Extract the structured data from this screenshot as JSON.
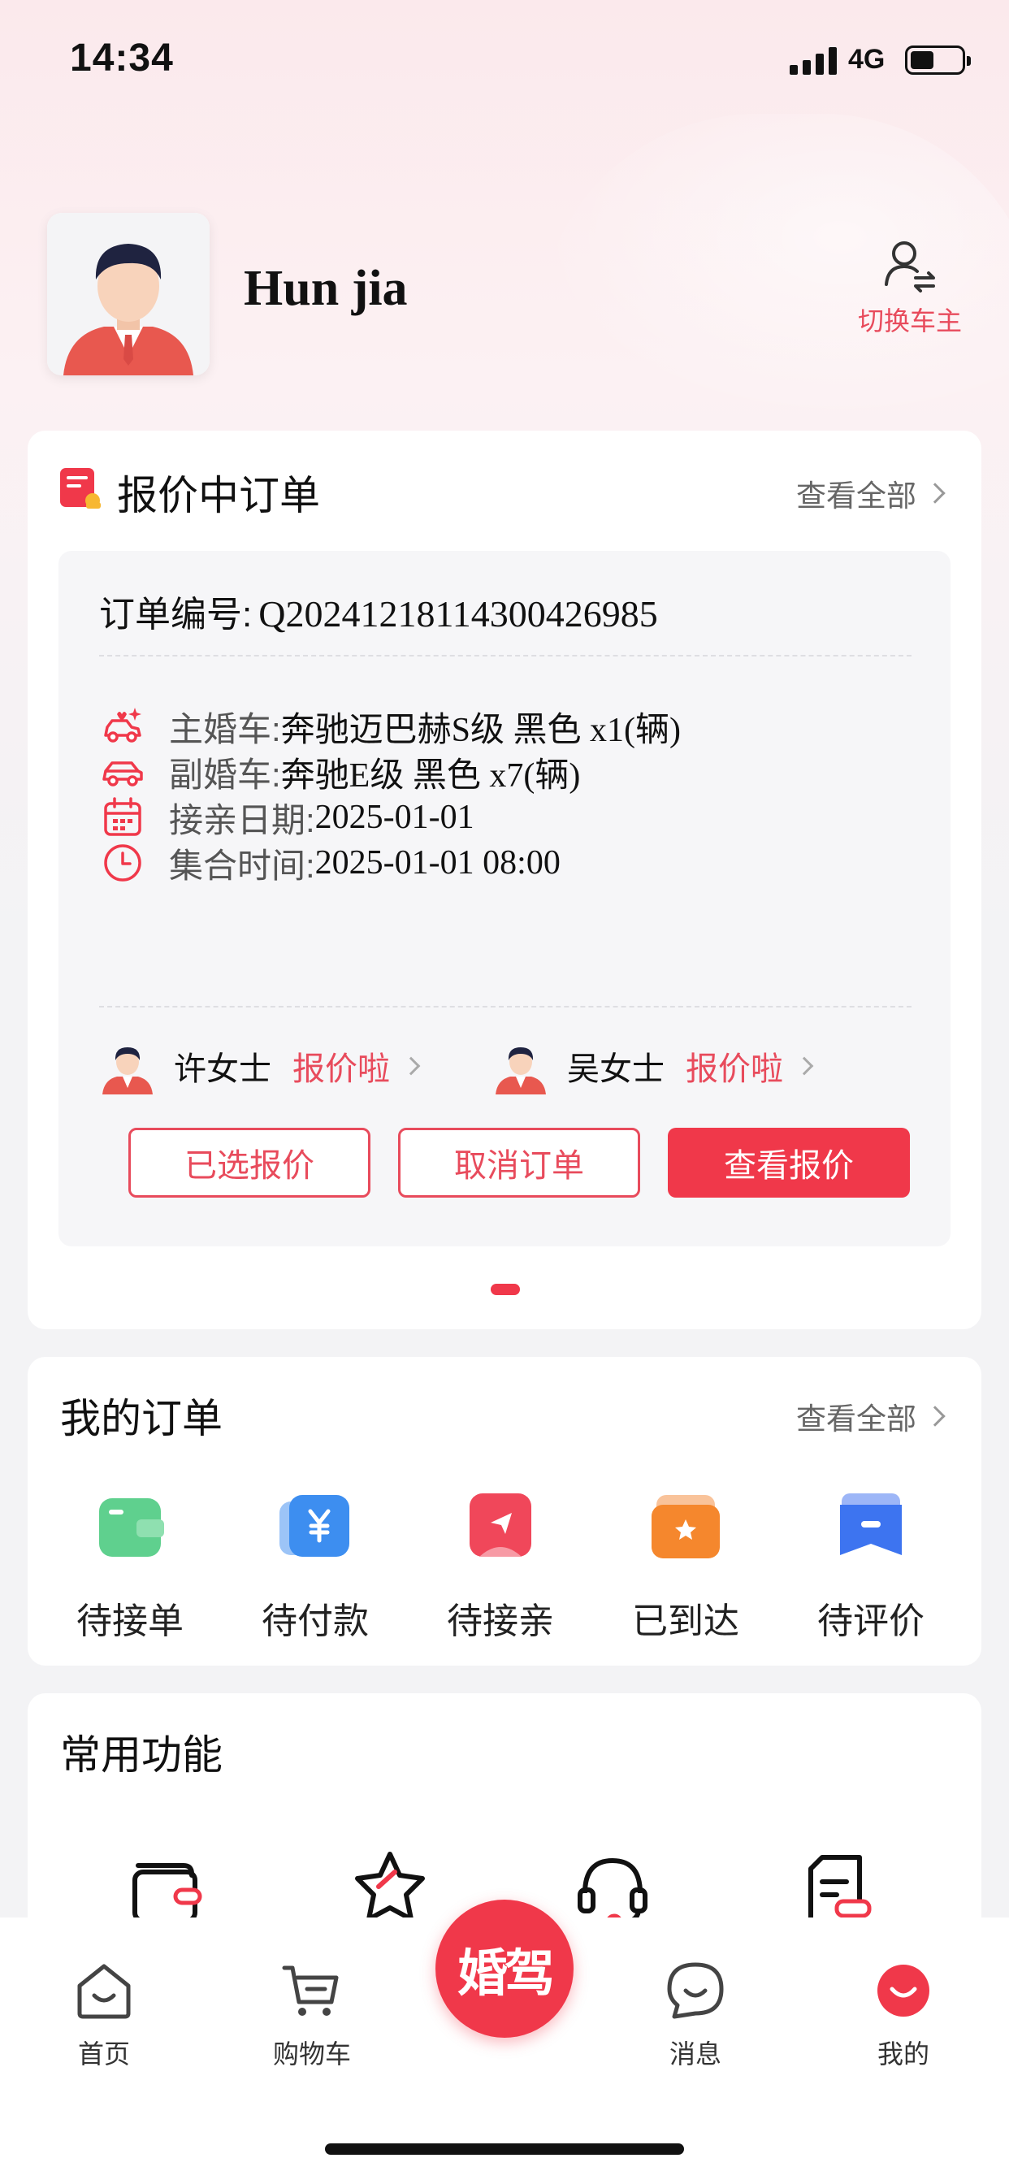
{
  "status_bar": {
    "time": "14:34",
    "network": "4G"
  },
  "profile": {
    "name": "Hun jia",
    "switch_label": "切换车主"
  },
  "quote_card": {
    "title": "报价中订单",
    "view_all": "查看全部",
    "order_no_label": "订单编号:",
    "order_no": "Q20241218114300426985",
    "rows": [
      {
        "key": "主婚车:",
        "value": "奔驰迈巴赫S级 黑色 x1(辆)",
        "icon": "wedding-car-icon"
      },
      {
        "key": "副婚车:",
        "value": "奔驰E级 黑色 x7(辆)",
        "icon": "car-icon"
      },
      {
        "key": "接亲日期:",
        "value": "2025-01-01",
        "icon": "calendar-icon"
      },
      {
        "key": "集合时间:",
        "value": "2025-01-01 08:00",
        "icon": "clock-icon"
      }
    ],
    "bidders": [
      {
        "name": "许女士",
        "status": "报价啦"
      },
      {
        "name": "吴女士",
        "status": "报价啦"
      }
    ],
    "buttons": {
      "selected": "已选报价",
      "cancel": "取消订单",
      "view": "查看报价"
    }
  },
  "my_orders": {
    "title": "我的订单",
    "view_all": "查看全部",
    "items": [
      {
        "label": "待接单",
        "icon": "wallet-icon",
        "color": "#5fd08e"
      },
      {
        "label": "待付款",
        "icon": "yen-icon",
        "color": "#3d8ef0"
      },
      {
        "label": "待接亲",
        "icon": "send-icon",
        "color": "#f0475a"
      },
      {
        "label": "已到达",
        "icon": "folder-icon",
        "color": "#f5872d"
      },
      {
        "label": "待评价",
        "icon": "review-icon",
        "color": "#3d74f0"
      }
    ]
  },
  "functions": {
    "title": "常用功能"
  },
  "tabbar": {
    "items": [
      {
        "label": "首页",
        "icon": "home-icon"
      },
      {
        "label": "购物车",
        "icon": "cart-icon"
      },
      {
        "label": "消息",
        "icon": "message-icon"
      },
      {
        "label": "我的",
        "icon": "profile-icon"
      }
    ],
    "center_label": "婚驾"
  },
  "colors": {
    "accent": "#f0384a",
    "accent_text": "#e84b5c"
  }
}
